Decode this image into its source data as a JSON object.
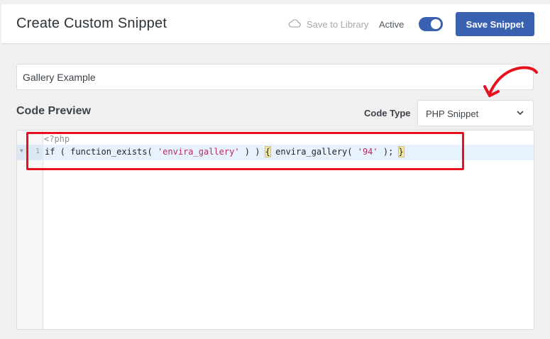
{
  "header": {
    "title": "Create Custom Snippet",
    "save_to_library": "Save to Library",
    "active_label": "Active",
    "active_toggle": true,
    "save_button": "Save Snippet"
  },
  "snippet": {
    "title_value": "Gallery Example"
  },
  "code_preview": {
    "section_title": "Code Preview",
    "code_type_label": "Code Type",
    "code_type_value": "PHP Snippet",
    "php_open_tag": "<?php",
    "line_number": "1",
    "code_parts": {
      "p1": "if ( function_exists( ",
      "s1": "'envira_gallery'",
      "p2": " ) ) ",
      "b1": "{",
      "p3": " envira_gallery( ",
      "s2": "'94'",
      "p4": " ); ",
      "b2": "}"
    }
  },
  "colors": {
    "accent": "#3a61b1",
    "annotation": "#e8101e"
  }
}
